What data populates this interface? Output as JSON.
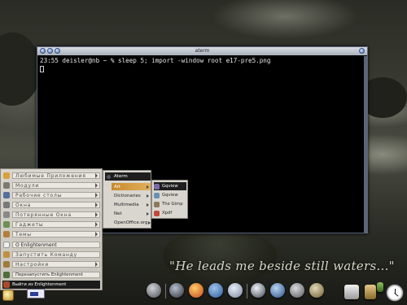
{
  "window": {
    "title": "aterm",
    "terminal_line": "23:55 deisler@nb ~ % sleep 5; import -window root e17-pre5.png"
  },
  "menu": {
    "items": [
      {
        "label": "Любимые Приложения",
        "icon": "star-icon",
        "color": "#d8a23a",
        "submenu": true
      },
      {
        "label": "Модули",
        "icon": "puzzle-icon",
        "color": "#7f7a70",
        "submenu": true
      },
      {
        "label": "Рабочие столы",
        "icon": "desktop-icon",
        "color": "#556ea0",
        "submenu": true
      },
      {
        "label": "Окна",
        "icon": "window-icon",
        "color": "#77787a",
        "submenu": true
      },
      {
        "label": "Потерянные Окна",
        "icon": "lost-window-icon",
        "color": "#888",
        "submenu": true
      },
      {
        "label": "Гаджеты",
        "icon": "gadget-icon",
        "color": "#6d8f55",
        "submenu": true
      },
      {
        "label": "Темы",
        "icon": "theme-icon",
        "color": "#b57d3a",
        "submenu": true
      },
      {
        "label": "О Enlightenment",
        "icon": "info-icon",
        "color": "#eeeeee",
        "submenu": false
      },
      {
        "label": "Запустить Команду",
        "icon": "run-icon",
        "color": "#c09040",
        "submenu": false
      },
      {
        "label": "Настройки",
        "icon": "settings-icon",
        "color": "#a07a3a",
        "submenu": true
      },
      {
        "label": "Перезапустить Enlightenment",
        "icon": "restart-icon",
        "color": "#4d6e3a",
        "submenu": false
      },
      {
        "label": "Выйти из Enlightenment",
        "icon": "exit-icon",
        "color": "#ab4a2a",
        "submenu": false,
        "selected": true
      }
    ]
  },
  "submenu1": {
    "header": "Aterm",
    "items": [
      {
        "label": "Art",
        "selected": true
      },
      {
        "label": "Dictionaries"
      },
      {
        "label": "Multimedia"
      },
      {
        "label": "Net"
      },
      {
        "label": "OpenOffice.org"
      }
    ]
  },
  "submenu2": {
    "items": [
      {
        "label": "Gqview",
        "selected": true
      },
      {
        "label": "Gqview"
      },
      {
        "label": "The Gimp"
      },
      {
        "label": "Xpdf"
      }
    ]
  },
  "wallpaper": {
    "quote": "\"He leads me beside still waters...\""
  },
  "dock": {
    "icons": [
      "gear-icon",
      "terminal-icon",
      "firefox-icon",
      "thunderbird-icon",
      "email-icon",
      "media-icon",
      "globe-icon",
      "pen-icon",
      "bottle-icon"
    ]
  },
  "tray": {
    "icons": [
      "trash-icon",
      "package-icon",
      "battery-icon",
      "clock-icon"
    ]
  }
}
